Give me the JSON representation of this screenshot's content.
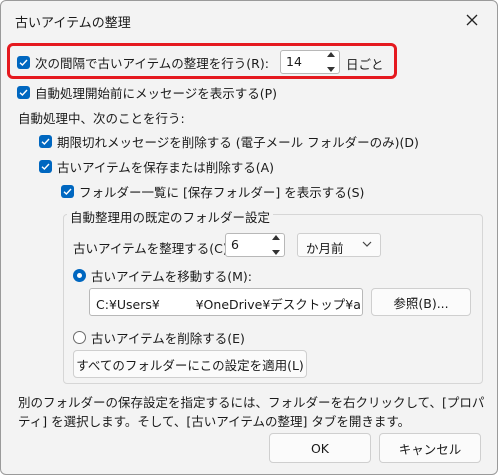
{
  "window": {
    "title": "古いアイテムの整理"
  },
  "interval": {
    "label": "次の間隔で古いアイテムの整理を行う(R):",
    "value": "14",
    "unit": "日ごと"
  },
  "prompt_before": {
    "label": "自動処理開始前にメッセージを表示する(P)"
  },
  "during_heading": "自動処理中、次のことを行う:",
  "delete_expired": {
    "label": "期限切れメッセージを削除する (電子メール フォルダーのみ)(D)"
  },
  "archive_or_delete": {
    "label": "古いアイテムを保存または削除する(A)"
  },
  "show_archive_folder": {
    "label": "フォルダー一覧に [保存フォルダー] を表示する(S)"
  },
  "default_settings": {
    "group_label": "自動整理用の既定のフォルダー設定",
    "clean_older_label": "古いアイテムを整理する(C)",
    "clean_older_value": "6",
    "period": "か月前",
    "move_label": "古いアイテムを移動する(M):",
    "path": "C:¥Users¥         ¥OneDrive¥デスクトップ¥a",
    "browse": "参照(B)...",
    "delete_label": "古いアイテムを削除する(E)",
    "apply_all": "すべてのフォルダーにこの設定を適用(L)"
  },
  "info": "別のフォルダーの保存設定を指定するには、フォルダーを右クリックして、[プロパティ] を選択します。そして、[古いアイテムの整理] タブを開きます。",
  "buttons": {
    "ok": "OK",
    "cancel": "キャンセル"
  },
  "colors": {
    "accent": "#0067c0",
    "highlight": "#e5191f"
  },
  "icons": {
    "close": "close-icon",
    "check": "checkmark-icon",
    "spin": "spin-arrows-icon",
    "dropdown": "chevron-down-icon"
  }
}
